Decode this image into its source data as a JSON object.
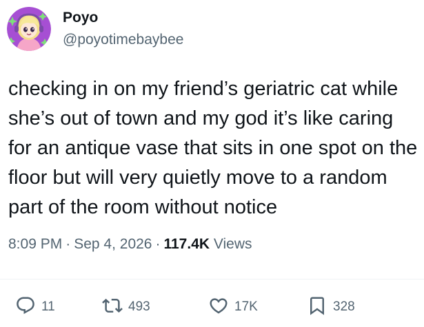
{
  "author": {
    "display_name": "Poyo",
    "handle": "@poyotimebaybee"
  },
  "tweet": {
    "text": "checking in on my friend’s geriatric cat while she’s out of town and my god it’s like caring for an antique vase that sits in one spot on the floor but will very quietly move to a random part of the room without notice"
  },
  "meta": {
    "time": "8:09 PM",
    "separator": "·",
    "date": "Sep 4, 2026",
    "views_count": "117.4K",
    "views_label": "Views"
  },
  "actions": {
    "reply_count": "11",
    "repost_count": "493",
    "like_count": "17K",
    "bookmark_count": "328"
  },
  "icons": {
    "reply": "reply-icon",
    "repost": "repost-icon",
    "like": "heart-icon",
    "bookmark": "bookmark-icon"
  },
  "colors": {
    "primary_text": "#0f1419",
    "secondary_text": "#536471",
    "divider": "#eff3f4",
    "avatar_bg": "#a64fd3"
  }
}
